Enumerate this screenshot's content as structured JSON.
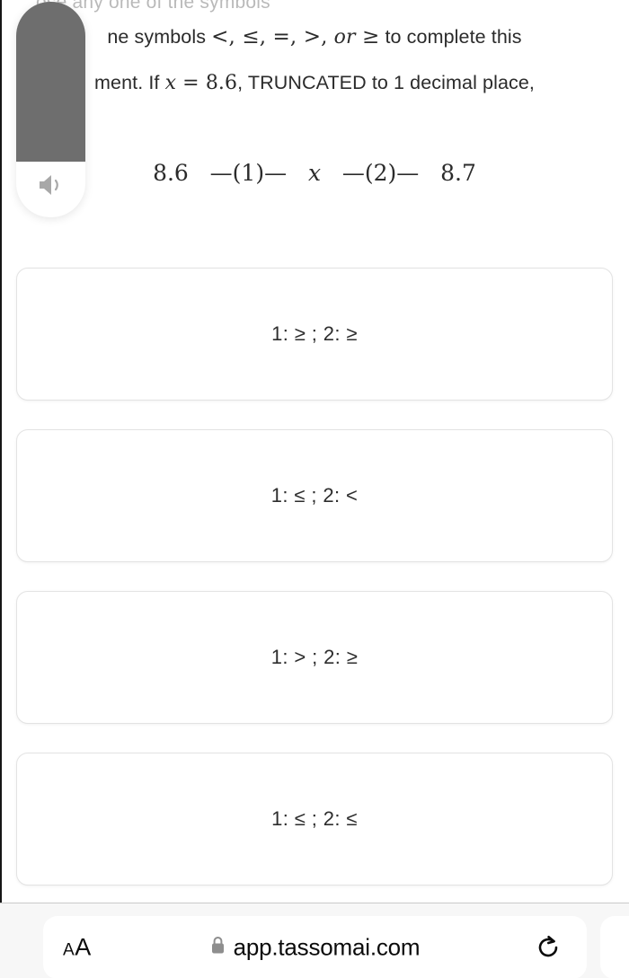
{
  "browser": {
    "toolbar": {
      "text_size_small": "A",
      "text_size_large": "A",
      "lock_icon": "lock-icon",
      "url": "app.tassomai.com",
      "reload_icon": "reload-icon"
    }
  },
  "hud": {
    "type": "volume-indicator",
    "icon": "speaker-icon",
    "level_percent": 74,
    "fill_color": "#6e6e6e",
    "track_color": "#ffffff"
  },
  "quiz": {
    "clipped_top_line": "ose any one of the symbols",
    "question_line_1_prefix": "ne symbols ",
    "question_symbols": "<, ≤, =, >,",
    "question_or": "or",
    "question_ge": "≥",
    "question_line_1_suffix": " to complete this",
    "question_line_2_prefix": "ment. If ",
    "question_x": "x",
    "question_eq_value": " = 8.6",
    "question_line_2_suffix": ", TRUNCATED to 1 decimal place,",
    "equation": {
      "left_value": "8.6",
      "blank_1": "—(1)—",
      "variable": "x",
      "blank_2": "—(2)—",
      "right_value": "8.7"
    },
    "options": [
      {
        "label": "1: ≥ ; 2: ≥"
      },
      {
        "label": "1: ≤ ; 2: <"
      },
      {
        "label": "1: > ; 2: ≥"
      },
      {
        "label": "1: ≤ ; 2: ≤"
      }
    ]
  }
}
